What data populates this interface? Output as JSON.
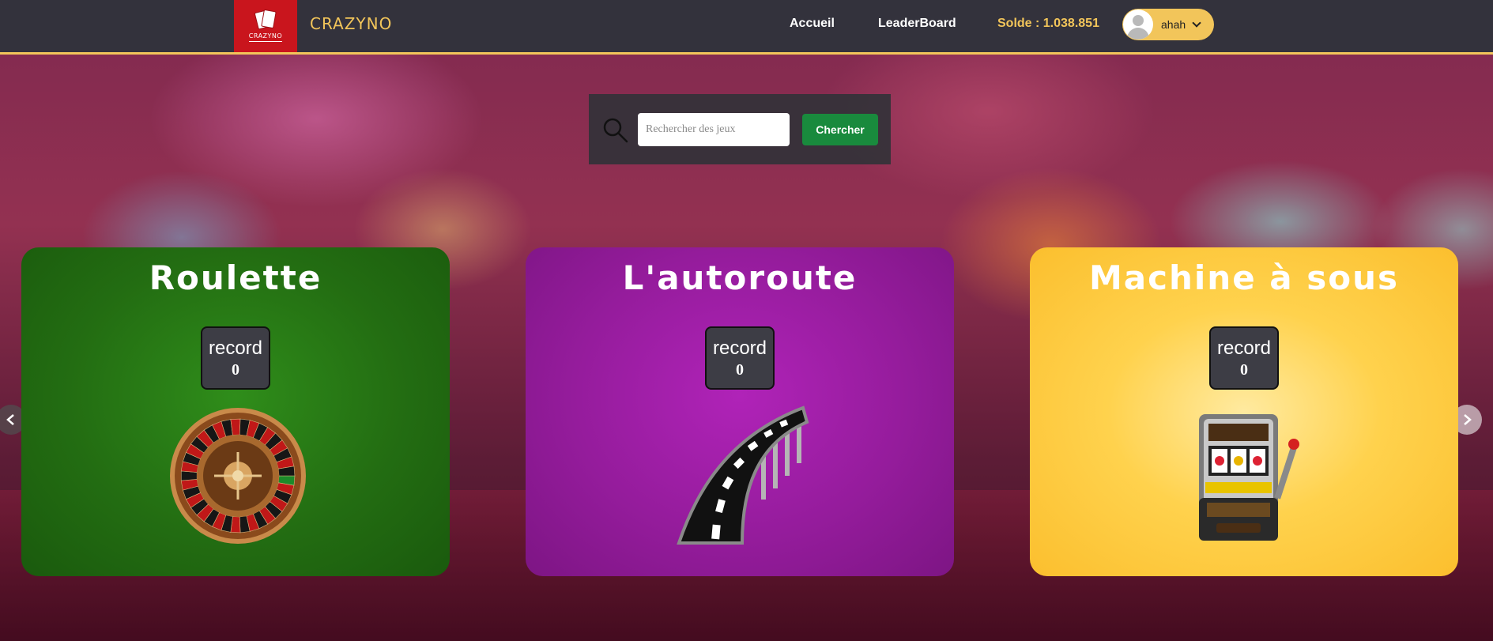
{
  "header": {
    "logo_text": "CRAZYNO",
    "brand": "CRAZYNO",
    "nav": {
      "home": "Accueil",
      "leaderboard": "LeaderBoard"
    },
    "balance": "Solde : 1.038.851",
    "user": {
      "name": "ahah"
    }
  },
  "search": {
    "placeholder": "Rechercher des jeux",
    "value": "",
    "button": "Chercher"
  },
  "games": [
    {
      "title": "Roulette",
      "record_label": "record",
      "record_value": "0",
      "icon": "roulette-wheel-icon"
    },
    {
      "title": "L'autoroute",
      "record_label": "record",
      "record_value": "0",
      "icon": "highway-road-icon"
    },
    {
      "title": "Machine à sous",
      "record_label": "record",
      "record_value": "0",
      "icon": "slot-machine-icon"
    }
  ],
  "colors": {
    "header_bg": "#33323c",
    "accent": "#f2c55a",
    "logo_red": "#c9151d",
    "search_button": "#198a3d",
    "card_roulette": "#236d12",
    "card_autoroute": "#951c9c",
    "card_slot": "#fbbf2e"
  }
}
